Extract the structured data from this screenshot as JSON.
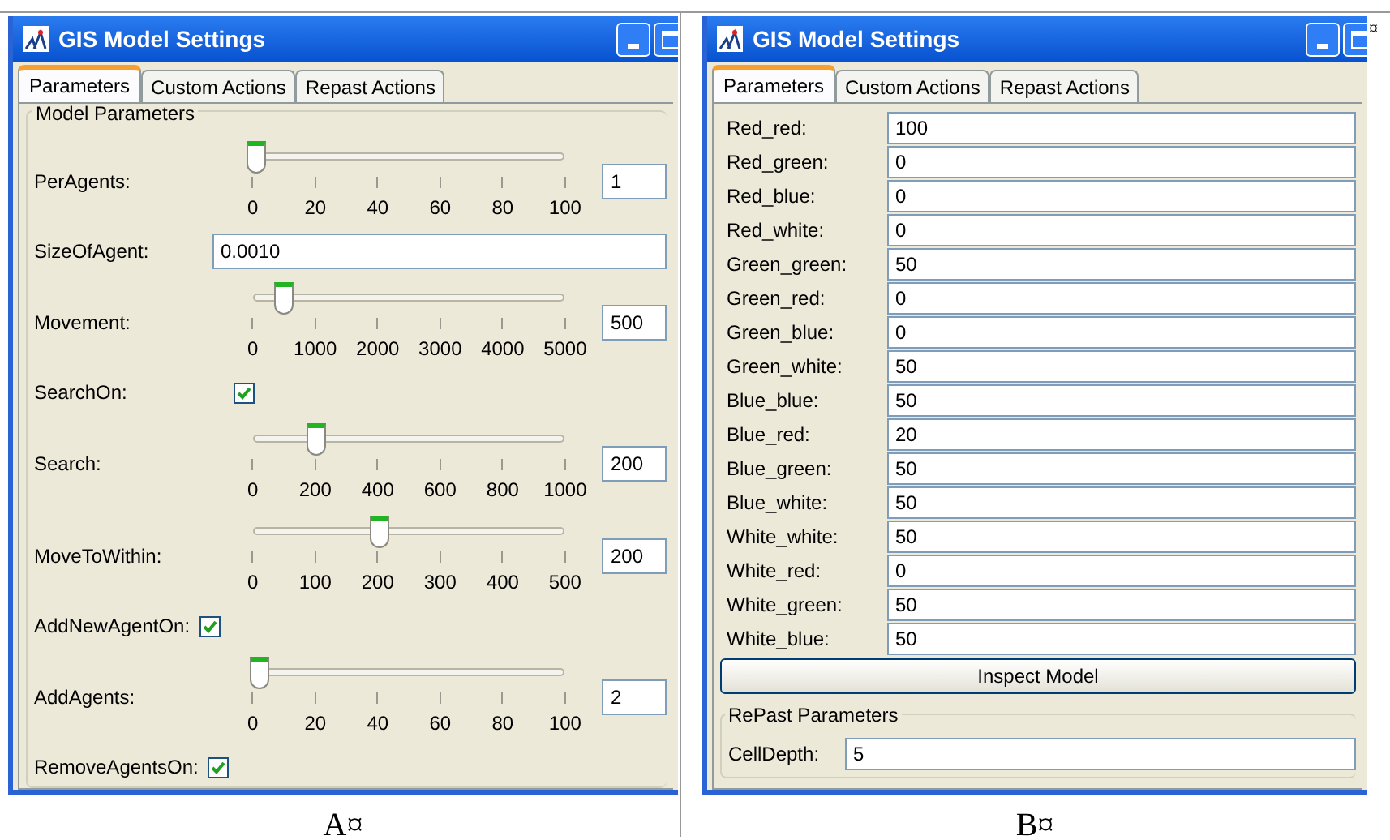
{
  "panels": [
    {
      "caption": "A¤",
      "window": {
        "title": "GIS Model Settings"
      },
      "tabs": [
        {
          "label": "Parameters",
          "selected": true
        },
        {
          "label": "Custom Actions",
          "selected": false
        },
        {
          "label": "Repast Actions",
          "selected": false
        }
      ],
      "group": {
        "title": "Model Parameters"
      },
      "parameters": [
        {
          "kind": "slider",
          "label": "PerAgents:",
          "ticks": [
            "0",
            "20",
            "40",
            "60",
            "80",
            "100"
          ],
          "level": 0.01,
          "value": "1"
        },
        {
          "kind": "text",
          "label": "SizeOfAgent:",
          "value": "0.0010"
        },
        {
          "kind": "slider",
          "label": "Movement:",
          "ticks": [
            "0",
            "1000",
            "2000",
            "3000",
            "4000",
            "5000"
          ],
          "level": 0.1,
          "value": "500"
        },
        {
          "kind": "checkbox",
          "label": "SearchOn:",
          "checked": true
        },
        {
          "kind": "slider",
          "label": "Search:",
          "ticks": [
            "0",
            "200",
            "400",
            "600",
            "800",
            "1000"
          ],
          "level": 0.2,
          "value": "200"
        },
        {
          "kind": "slider",
          "label": "MoveToWithin:",
          "ticks": [
            "0",
            "100",
            "200",
            "300",
            "400",
            "500"
          ],
          "level": 0.4,
          "value": "200"
        },
        {
          "kind": "checkbox",
          "label": "AddNewAgentOn:",
          "checked": true
        },
        {
          "kind": "slider",
          "label": "AddAgents:",
          "ticks": [
            "0",
            "20",
            "40",
            "60",
            "80",
            "100"
          ],
          "level": 0.02,
          "value": "2"
        },
        {
          "kind": "checkbox",
          "label": "RemoveAgentsOn:",
          "checked": true
        }
      ]
    },
    {
      "caption": "B¤",
      "corner_mark": "¤",
      "window": {
        "title": "GIS Model Settings"
      },
      "tabs": [
        {
          "label": "Parameters",
          "selected": true
        },
        {
          "label": "Custom Actions",
          "selected": false
        },
        {
          "label": "Repast Actions",
          "selected": false
        }
      ],
      "parameters": [
        {
          "kind": "field",
          "label": "Red_red:",
          "value": "100"
        },
        {
          "kind": "field",
          "label": "Red_green:",
          "value": "0"
        },
        {
          "kind": "field",
          "label": "Red_blue:",
          "value": "0"
        },
        {
          "kind": "field",
          "label": "Red_white:",
          "value": "0"
        },
        {
          "kind": "field",
          "label": "Green_green:",
          "value": "50"
        },
        {
          "kind": "field",
          "label": "Green_red:",
          "value": "0"
        },
        {
          "kind": "field",
          "label": "Green_blue:",
          "value": "0"
        },
        {
          "kind": "field",
          "label": "Green_white:",
          "value": "50"
        },
        {
          "kind": "field",
          "label": "Blue_blue:",
          "value": "50"
        },
        {
          "kind": "field",
          "label": "Blue_red:",
          "value": "20"
        },
        {
          "kind": "field",
          "label": "Blue_green:",
          "value": "50"
        },
        {
          "kind": "field",
          "label": "Blue_white:",
          "value": "50"
        },
        {
          "kind": "field",
          "label": "White_white:",
          "value": "50"
        },
        {
          "kind": "field",
          "label": "White_red:",
          "value": "0"
        },
        {
          "kind": "field",
          "label": "White_green:",
          "value": "50"
        },
        {
          "kind": "field",
          "label": "White_blue:",
          "value": "50"
        }
      ],
      "button": "Inspect Model",
      "group": {
        "title": "RePast Parameters"
      },
      "group_parameters": [
        {
          "kind": "field",
          "label": "CellDepth:",
          "value": "5"
        }
      ]
    }
  ]
}
